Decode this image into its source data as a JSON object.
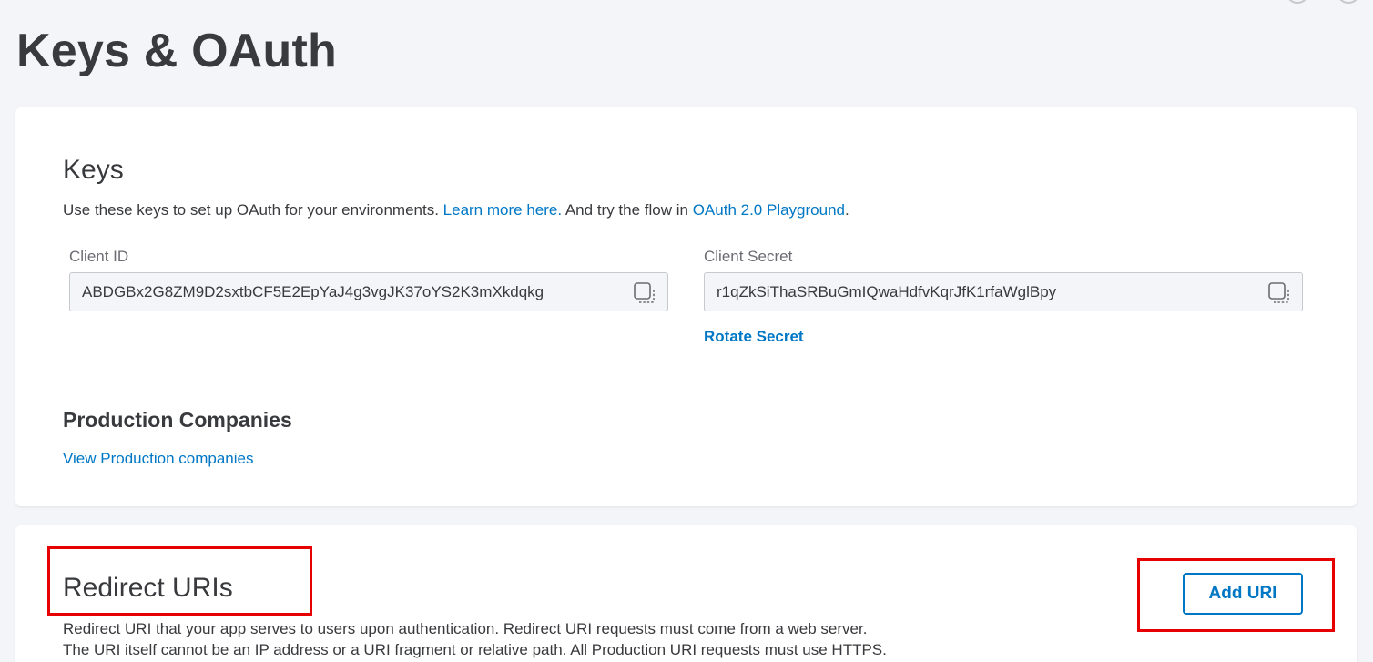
{
  "page": {
    "title": "Keys & OAuth"
  },
  "keys": {
    "title": "Keys",
    "description_prefix": "Use these keys to set up OAuth for your environments. ",
    "learn_more_link": "Learn more here.",
    "description_middle": " And try the flow in ",
    "playground_link": "OAuth 2.0 Playground",
    "description_suffix": ".",
    "client_id": {
      "label": "Client ID",
      "value": "ABDGBx2G8ZM9D2sxtbCF5E2EpYaJ4g3vgJK37oYS2K3mXkdqkg"
    },
    "client_secret": {
      "label": "Client Secret",
      "value": "r1qZkSiThaSRBuGmIQwaHdfvKqrJfK1rfaWglBpy"
    },
    "rotate_secret_label": "Rotate Secret"
  },
  "production": {
    "title": "Production Companies",
    "view_link": "View Production companies"
  },
  "redirect": {
    "title": "Redirect URIs",
    "add_uri_label": "Add URI",
    "description_line1": "Redirect URI that your app serves to users upon authentication. Redirect URI requests must come from a web server.",
    "description_line2": "The URI itself cannot be an IP address or a URI fragment or relative path. All Production URI requests must use HTTPS."
  },
  "icons": {
    "copy": "copy-icon",
    "top_right": [
      "help-icon",
      "settings-icon"
    ]
  },
  "colors": {
    "link": "#0077c5",
    "text": "#393a3d",
    "background": "#f4f5f8",
    "highlight": "#e60000"
  }
}
